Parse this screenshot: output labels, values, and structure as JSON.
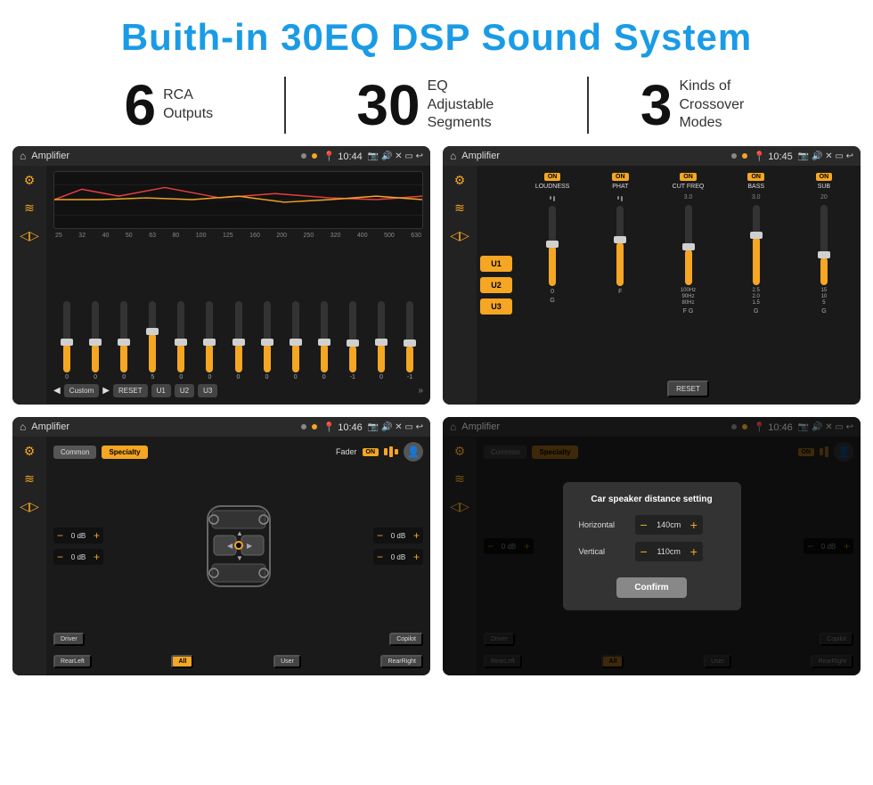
{
  "header": {
    "title": "Buith-in 30EQ DSP Sound System"
  },
  "stats": [
    {
      "number": "6",
      "text": "RCA\nOutputs"
    },
    {
      "number": "30",
      "text": "EQ Adjustable\nSegments"
    },
    {
      "number": "3",
      "text": "Kinds of\nCrossover Modes"
    }
  ],
  "screens": [
    {
      "id": "screen1",
      "title": "Amplifier",
      "time": "10:44",
      "type": "eq",
      "freqs": [
        "25",
        "32",
        "40",
        "50",
        "63",
        "80",
        "100",
        "125",
        "160",
        "200",
        "250",
        "320",
        "400",
        "500",
        "630"
      ],
      "values": [
        "0",
        "0",
        "0",
        "5",
        "0",
        "0",
        "0",
        "0",
        "0",
        "0",
        "-1",
        "0",
        "-1"
      ],
      "bottomBtns": [
        "Custom",
        "RESET",
        "U1",
        "U2",
        "U3"
      ]
    },
    {
      "id": "screen2",
      "title": "Amplifier",
      "time": "10:45",
      "type": "amp",
      "presets": [
        "U1",
        "U2",
        "U3"
      ],
      "sections": [
        {
          "label": "LOUDNESS",
          "state": "ON"
        },
        {
          "label": "PHAT",
          "state": "ON"
        },
        {
          "label": "CUT FREQ",
          "state": "ON"
        },
        {
          "label": "BASS",
          "state": "ON"
        },
        {
          "label": "SUB",
          "state": "ON"
        }
      ]
    },
    {
      "id": "screen3",
      "title": "Amplifier",
      "time": "10:46",
      "type": "fader",
      "tabs": [
        "Common",
        "Specialty"
      ],
      "activeTab": "Specialty",
      "faderLabel": "Fader",
      "faderOn": "ON",
      "controls": [
        {
          "label": "0 dB"
        },
        {
          "label": "0 dB"
        },
        {
          "label": "0 dB"
        },
        {
          "label": "0 dB"
        }
      ],
      "bottomBtns": [
        "Driver",
        "Copilot",
        "RearLeft",
        "All",
        "User",
        "RearRight"
      ]
    },
    {
      "id": "screen4",
      "title": "Amplifier",
      "time": "10:46",
      "type": "distance",
      "tabs": [
        "Common",
        "Specialty"
      ],
      "dialog": {
        "title": "Car speaker distance setting",
        "horizontal": {
          "label": "Horizontal",
          "value": "140cm"
        },
        "vertical": {
          "label": "Vertical",
          "value": "110cm"
        },
        "confirm": "Confirm"
      },
      "controls": [
        {
          "label": "0 dB"
        },
        {
          "label": "0 dB"
        }
      ],
      "bottomBtns": [
        "Driver",
        "Copilot",
        "RearLeft",
        "All",
        "User",
        "RearRight"
      ]
    }
  ]
}
